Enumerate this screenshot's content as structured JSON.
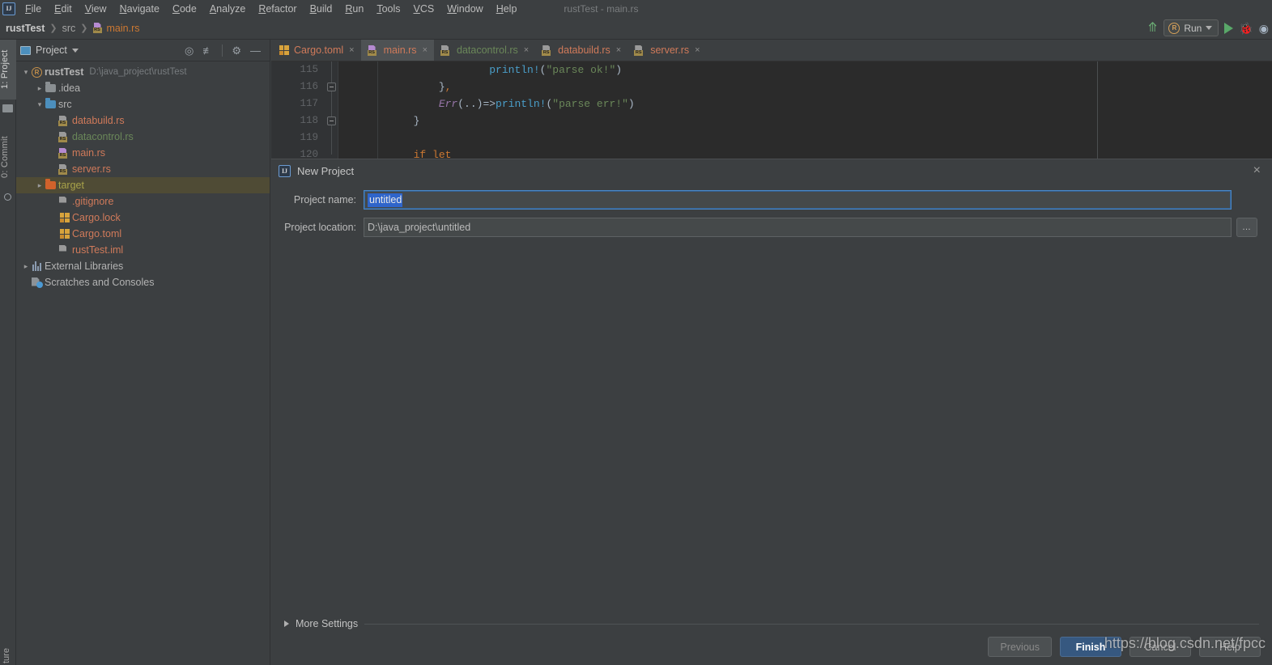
{
  "window": {
    "title": "rustTest - main.rs",
    "logo": "intellij-idea-logo"
  },
  "menubar": {
    "items": [
      {
        "label": "File"
      },
      {
        "label": "Edit"
      },
      {
        "label": "View"
      },
      {
        "label": "Navigate"
      },
      {
        "label": "Code"
      },
      {
        "label": "Analyze"
      },
      {
        "label": "Refactor"
      },
      {
        "label": "Build"
      },
      {
        "label": "Run"
      },
      {
        "label": "Tools"
      },
      {
        "label": "VCS"
      },
      {
        "label": "Window"
      },
      {
        "label": "Help"
      }
    ]
  },
  "breadcrumb": {
    "project": "rustTest",
    "folder": "src",
    "file": "main.rs",
    "separator": "❯"
  },
  "toolbar": {
    "build_icon": "hammer-icon",
    "run_config": "Run",
    "run_icon": "play-icon",
    "debug_icon": "bug-icon",
    "more_icon": "more-icon"
  },
  "toolstrip": {
    "tabs": [
      {
        "label": "1: Project",
        "active": true
      },
      {
        "label": "0: Commit",
        "active": false
      }
    ],
    "bottom_tab": "ture"
  },
  "project_panel": {
    "title": "Project",
    "icons": [
      "locate-icon",
      "collapse-all-icon",
      "gear-icon",
      "minimize-icon"
    ],
    "tree": [
      {
        "indent": 0,
        "arrow": "⌄",
        "icon": "rust-project-icon",
        "label": "rustTest",
        "bold": true,
        "path": "D:\\java_project\\rustTest",
        "color": "gray",
        "selected": false
      },
      {
        "indent": 1,
        "arrow": "›",
        "icon": "folder-gray-icon",
        "label": ".idea",
        "color": "gray",
        "selected": false
      },
      {
        "indent": 1,
        "arrow": "⌄",
        "icon": "folder-blue-icon",
        "label": "src",
        "color": "gray",
        "selected": false
      },
      {
        "indent": 2,
        "arrow": "",
        "icon": "rust-file-icon",
        "label": "databuild.rs",
        "color": "salmon",
        "selected": false
      },
      {
        "indent": 2,
        "arrow": "",
        "icon": "rust-file-icon",
        "label": "datacontrol.rs",
        "color": "green",
        "selected": false
      },
      {
        "indent": 2,
        "arrow": "",
        "icon": "rust-file-purple-icon",
        "label": "main.rs",
        "color": "salmon",
        "selected": false
      },
      {
        "indent": 2,
        "arrow": "",
        "icon": "rust-file-icon",
        "label": "server.rs",
        "color": "salmon",
        "selected": false
      },
      {
        "indent": 1,
        "arrow": "›",
        "icon": "folder-orange-icon",
        "label": "target",
        "color": "yellowgreen",
        "selected": true
      },
      {
        "indent": 2,
        "arrow": "",
        "icon": "gitignore-icon",
        "label": ".gitignore",
        "color": "salmon",
        "selected": false
      },
      {
        "indent": 2,
        "arrow": "",
        "icon": "cargo-lock-icon",
        "label": "Cargo.lock",
        "color": "salmon",
        "selected": false
      },
      {
        "indent": 2,
        "arrow": "",
        "icon": "cargo-toml-icon",
        "label": "Cargo.toml",
        "color": "salmon",
        "selected": false
      },
      {
        "indent": 2,
        "arrow": "",
        "icon": "iml-file-icon",
        "label": "rustTest.iml",
        "color": "salmon",
        "selected": false
      },
      {
        "indent": 0,
        "arrow": "›",
        "icon": "libraries-icon",
        "label": "External Libraries",
        "color": "gray",
        "selected": false
      },
      {
        "indent": 0,
        "arrow": "",
        "icon": "scratches-icon",
        "label": "Scratches and Consoles",
        "color": "gray",
        "selected": false
      }
    ]
  },
  "editor": {
    "tabs": [
      {
        "label": "Cargo.toml",
        "icon": "cargo-toml-icon",
        "color": "salmon",
        "active": false
      },
      {
        "label": "main.rs",
        "icon": "rust-file-purple-icon",
        "color": "salmon",
        "active": true
      },
      {
        "label": "datacontrol.rs",
        "icon": "rust-file-icon",
        "color": "green",
        "active": false
      },
      {
        "label": "databuild.rs",
        "icon": "rust-file-icon",
        "color": "salmon",
        "active": false
      },
      {
        "label": "server.rs",
        "icon": "rust-file-icon",
        "color": "salmon",
        "active": false
      }
    ],
    "close_glyph": "×",
    "line_numbers": [
      "115",
      "116",
      "117",
      "118",
      "119",
      "120"
    ],
    "code_lines": [
      {
        "indent": 24,
        "tokens": [
          {
            "t": "println",
            "c": "k-mac"
          },
          {
            "t": "!",
            "c": "k-mac"
          },
          {
            "t": "(",
            "c": "k-plain"
          },
          {
            "t": "\"parse ok!\"",
            "c": "k-str"
          },
          {
            "t": ")",
            "c": "k-plain"
          }
        ]
      },
      {
        "indent": 16,
        "tokens": [
          {
            "t": "}",
            "c": "k-plain"
          },
          {
            "t": ",",
            "c": "k-orange"
          }
        ]
      },
      {
        "indent": 16,
        "tokens": [
          {
            "t": "Err",
            "c": "k-enum"
          },
          {
            "t": "(..)=>",
            "c": "k-plain"
          },
          {
            "t": "println",
            "c": "k-mac"
          },
          {
            "t": "!",
            "c": "k-mac"
          },
          {
            "t": "(",
            "c": "k-plain"
          },
          {
            "t": "\"parse err!\"",
            "c": "k-str"
          },
          {
            "t": ")",
            "c": "k-plain"
          }
        ]
      },
      {
        "indent": 12,
        "tokens": [
          {
            "t": "}",
            "c": "k-plain"
          }
        ]
      },
      {
        "indent": 0,
        "tokens": []
      },
      {
        "indent": 12,
        "tokens": [
          {
            "t": "if let ",
            "c": "k-orange"
          }
        ]
      }
    ]
  },
  "dialog": {
    "title": "New Project",
    "icon": "intellij-idea-logo",
    "close": "×",
    "fields": [
      {
        "label": "Project name:",
        "value": "untitled",
        "selected": true
      },
      {
        "label": "Project location:",
        "value": "D:\\java_project\\untitled",
        "selected": false
      }
    ],
    "browse_label": "…",
    "more_settings": "More Settings",
    "buttons": [
      {
        "label": "Previous",
        "style": "dim"
      },
      {
        "label": "Finish",
        "style": "primary"
      },
      {
        "label": "Cancel",
        "style": "normal"
      },
      {
        "label": "Help",
        "style": "normal"
      }
    ]
  },
  "watermark": "https://blog.csdn.net/fpcc",
  "colors": {
    "panel_bg": "#3c3f41",
    "editor_bg": "#2b2b2b",
    "gutter_bg": "#313335",
    "accent_blue": "#365880",
    "selection_blue": "#2f65ca",
    "tree_selection": "#4f4b35",
    "string_green": "#6a8759",
    "keyword_orange": "#cc7832",
    "macro_blue": "#4a9ec9",
    "enum_purple": "#9876aa"
  }
}
